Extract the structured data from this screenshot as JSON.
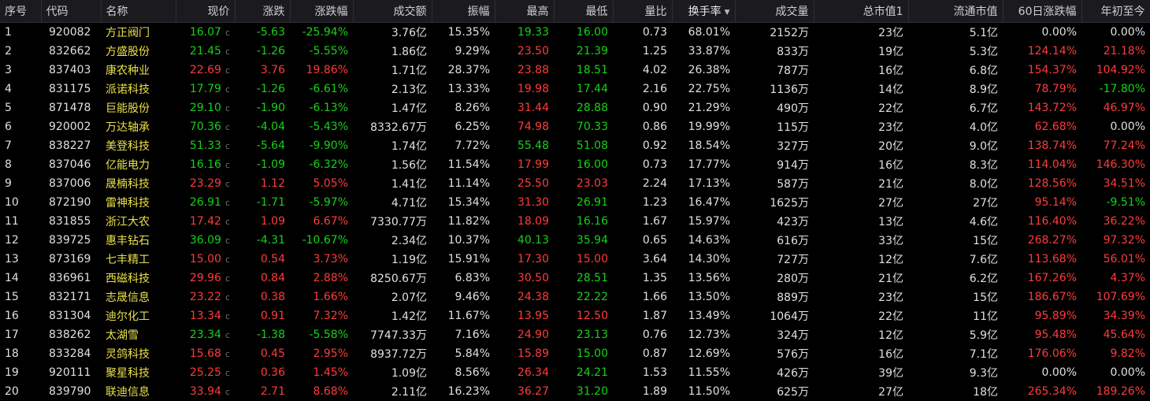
{
  "header": {
    "seq": "序号",
    "code": "代码",
    "name": "名称",
    "price": "现价",
    "change": "涨跌",
    "change_pct": "涨跌幅",
    "amount": "成交额",
    "amplitude": "振幅",
    "high": "最高",
    "low": "最低",
    "vol_ratio": "量比",
    "turnover": "换手率",
    "volume": "成交量",
    "total_cap": "总市值1",
    "float_cap": "流通市值",
    "chg60": "60日涨跌幅",
    "ytd": "年初至今"
  },
  "sort": {
    "column": "turnover",
    "direction": "desc",
    "indicator": "▼"
  },
  "price_suffix": "c",
  "colors": {
    "up": "#ff3b3b",
    "down": "#17d117",
    "flat": "#e0e0e0",
    "background": "#000000",
    "header_bg": "#1b1b1f"
  },
  "rows": [
    {
      "seq": "1",
      "code": "920082",
      "name": "方正阀门",
      "price": "16.07",
      "change": "-5.63",
      "change_pct": "-25.94%",
      "amount": "3.76亿",
      "amplitude": "15.35%",
      "high": "19.33",
      "low": "16.00",
      "vol_ratio": "0.73",
      "turnover": "68.01%",
      "volume": "2152万",
      "total_cap": "23亿",
      "float_cap": "5.1亿",
      "chg60": "0.00%",
      "ytd": "0.00%",
      "c": {
        "price": "g",
        "change": "g",
        "change_pct": "g",
        "high": "g",
        "low": "g",
        "chg60": "w",
        "ytd": "w"
      }
    },
    {
      "seq": "2",
      "code": "832662",
      "name": "方盛股份",
      "price": "21.45",
      "change": "-1.26",
      "change_pct": "-5.55%",
      "amount": "1.86亿",
      "amplitude": "9.29%",
      "high": "23.50",
      "low": "21.39",
      "vol_ratio": "1.25",
      "turnover": "33.87%",
      "volume": "833万",
      "total_cap": "19亿",
      "float_cap": "5.3亿",
      "chg60": "124.14%",
      "ytd": "21.18%",
      "c": {
        "price": "g",
        "change": "g",
        "change_pct": "g",
        "high": "r",
        "low": "g",
        "chg60": "r",
        "ytd": "r"
      }
    },
    {
      "seq": "3",
      "code": "837403",
      "name": "康农种业",
      "price": "22.69",
      "change": "3.76",
      "change_pct": "19.86%",
      "amount": "1.71亿",
      "amplitude": "28.37%",
      "high": "23.88",
      "low": "18.51",
      "vol_ratio": "4.02",
      "turnover": "26.38%",
      "volume": "787万",
      "total_cap": "16亿",
      "float_cap": "6.8亿",
      "chg60": "154.37%",
      "ytd": "104.92%",
      "c": {
        "price": "r",
        "change": "r",
        "change_pct": "r",
        "high": "r",
        "low": "g",
        "chg60": "r",
        "ytd": "r"
      }
    },
    {
      "seq": "4",
      "code": "831175",
      "name": "派诺科技",
      "price": "17.79",
      "change": "-1.26",
      "change_pct": "-6.61%",
      "amount": "2.13亿",
      "amplitude": "13.33%",
      "high": "19.98",
      "low": "17.44",
      "vol_ratio": "2.16",
      "turnover": "22.75%",
      "volume": "1136万",
      "total_cap": "14亿",
      "float_cap": "8.9亿",
      "chg60": "78.79%",
      "ytd": "-17.80%",
      "c": {
        "price": "g",
        "change": "g",
        "change_pct": "g",
        "high": "r",
        "low": "g",
        "chg60": "r",
        "ytd": "g"
      }
    },
    {
      "seq": "5",
      "code": "871478",
      "name": "巨能股份",
      "price": "29.10",
      "change": "-1.90",
      "change_pct": "-6.13%",
      "amount": "1.47亿",
      "amplitude": "8.26%",
      "high": "31.44",
      "low": "28.88",
      "vol_ratio": "0.90",
      "turnover": "21.29%",
      "volume": "490万",
      "total_cap": "22亿",
      "float_cap": "6.7亿",
      "chg60": "143.72%",
      "ytd": "46.97%",
      "c": {
        "price": "g",
        "change": "g",
        "change_pct": "g",
        "high": "r",
        "low": "g",
        "chg60": "r",
        "ytd": "r"
      }
    },
    {
      "seq": "6",
      "code": "920002",
      "name": "万达轴承",
      "price": "70.36",
      "change": "-4.04",
      "change_pct": "-5.43%",
      "amount": "8332.67万",
      "amplitude": "6.25%",
      "high": "74.98",
      "low": "70.33",
      "vol_ratio": "0.86",
      "turnover": "19.99%",
      "volume": "115万",
      "total_cap": "23亿",
      "float_cap": "4.0亿",
      "chg60": "62.68%",
      "ytd": "0.00%",
      "c": {
        "price": "g",
        "change": "g",
        "change_pct": "g",
        "high": "r",
        "low": "g",
        "chg60": "r",
        "ytd": "w"
      }
    },
    {
      "seq": "7",
      "code": "838227",
      "name": "美登科技",
      "price": "51.33",
      "change": "-5.64",
      "change_pct": "-9.90%",
      "amount": "1.74亿",
      "amplitude": "7.72%",
      "high": "55.48",
      "low": "51.08",
      "vol_ratio": "0.92",
      "turnover": "18.54%",
      "volume": "327万",
      "total_cap": "20亿",
      "float_cap": "9.0亿",
      "chg60": "138.74%",
      "ytd": "77.24%",
      "c": {
        "price": "g",
        "change": "g",
        "change_pct": "g",
        "high": "g",
        "low": "g",
        "chg60": "r",
        "ytd": "r"
      }
    },
    {
      "seq": "8",
      "code": "837046",
      "name": "亿能电力",
      "price": "16.16",
      "change": "-1.09",
      "change_pct": "-6.32%",
      "amount": "1.56亿",
      "amplitude": "11.54%",
      "high": "17.99",
      "low": "16.00",
      "vol_ratio": "0.73",
      "turnover": "17.77%",
      "volume": "914万",
      "total_cap": "16亿",
      "float_cap": "8.3亿",
      "chg60": "114.04%",
      "ytd": "146.30%",
      "c": {
        "price": "g",
        "change": "g",
        "change_pct": "g",
        "high": "r",
        "low": "g",
        "chg60": "r",
        "ytd": "r"
      }
    },
    {
      "seq": "9",
      "code": "837006",
      "name": "晟楠科技",
      "price": "23.29",
      "change": "1.12",
      "change_pct": "5.05%",
      "amount": "1.41亿",
      "amplitude": "11.14%",
      "high": "25.50",
      "low": "23.03",
      "vol_ratio": "2.24",
      "turnover": "17.13%",
      "volume": "587万",
      "total_cap": "21亿",
      "float_cap": "8.0亿",
      "chg60": "128.56%",
      "ytd": "34.51%",
      "c": {
        "price": "r",
        "change": "r",
        "change_pct": "r",
        "high": "r",
        "low": "r",
        "chg60": "r",
        "ytd": "r"
      }
    },
    {
      "seq": "10",
      "code": "872190",
      "name": "雷神科技",
      "price": "26.91",
      "change": "-1.71",
      "change_pct": "-5.97%",
      "amount": "4.71亿",
      "amplitude": "15.34%",
      "high": "31.30",
      "low": "26.91",
      "vol_ratio": "1.23",
      "turnover": "16.47%",
      "volume": "1625万",
      "total_cap": "27亿",
      "float_cap": "27亿",
      "chg60": "95.14%",
      "ytd": "-9.51%",
      "c": {
        "price": "g",
        "change": "g",
        "change_pct": "g",
        "high": "r",
        "low": "g",
        "chg60": "r",
        "ytd": "g"
      }
    },
    {
      "seq": "11",
      "code": "831855",
      "name": "浙江大农",
      "price": "17.42",
      "change": "1.09",
      "change_pct": "6.67%",
      "amount": "7330.77万",
      "amplitude": "11.82%",
      "high": "18.09",
      "low": "16.16",
      "vol_ratio": "1.67",
      "turnover": "15.97%",
      "volume": "423万",
      "total_cap": "13亿",
      "float_cap": "4.6亿",
      "chg60": "116.40%",
      "ytd": "36.22%",
      "c": {
        "price": "r",
        "change": "r",
        "change_pct": "r",
        "high": "r",
        "low": "g",
        "chg60": "r",
        "ytd": "r"
      }
    },
    {
      "seq": "12",
      "code": "839725",
      "name": "惠丰钻石",
      "price": "36.09",
      "change": "-4.31",
      "change_pct": "-10.67%",
      "amount": "2.34亿",
      "amplitude": "10.37%",
      "high": "40.13",
      "low": "35.94",
      "vol_ratio": "0.65",
      "turnover": "14.63%",
      "volume": "616万",
      "total_cap": "33亿",
      "float_cap": "15亿",
      "chg60": "268.27%",
      "ytd": "97.32%",
      "c": {
        "price": "g",
        "change": "g",
        "change_pct": "g",
        "high": "g",
        "low": "g",
        "chg60": "r",
        "ytd": "r"
      }
    },
    {
      "seq": "13",
      "code": "873169",
      "name": "七丰精工",
      "price": "15.00",
      "change": "0.54",
      "change_pct": "3.73%",
      "amount": "1.19亿",
      "amplitude": "15.91%",
      "high": "17.30",
      "low": "15.00",
      "vol_ratio": "3.64",
      "turnover": "14.30%",
      "volume": "727万",
      "total_cap": "12亿",
      "float_cap": "7.6亿",
      "chg60": "113.68%",
      "ytd": "56.01%",
      "c": {
        "price": "r",
        "change": "r",
        "change_pct": "r",
        "high": "r",
        "low": "r",
        "chg60": "r",
        "ytd": "r"
      }
    },
    {
      "seq": "14",
      "code": "836961",
      "name": "西磁科技",
      "price": "29.96",
      "change": "0.84",
      "change_pct": "2.88%",
      "amount": "8250.67万",
      "amplitude": "6.83%",
      "high": "30.50",
      "low": "28.51",
      "vol_ratio": "1.35",
      "turnover": "13.56%",
      "volume": "280万",
      "total_cap": "21亿",
      "float_cap": "6.2亿",
      "chg60": "167.26%",
      "ytd": "4.37%",
      "c": {
        "price": "r",
        "change": "r",
        "change_pct": "r",
        "high": "r",
        "low": "g",
        "chg60": "r",
        "ytd": "r"
      }
    },
    {
      "seq": "15",
      "code": "832171",
      "name": "志晟信息",
      "price": "23.22",
      "change": "0.38",
      "change_pct": "1.66%",
      "amount": "2.07亿",
      "amplitude": "9.46%",
      "high": "24.38",
      "low": "22.22",
      "vol_ratio": "1.66",
      "turnover": "13.50%",
      "volume": "889万",
      "total_cap": "23亿",
      "float_cap": "15亿",
      "chg60": "186.67%",
      "ytd": "107.69%",
      "c": {
        "price": "r",
        "change": "r",
        "change_pct": "r",
        "high": "r",
        "low": "g",
        "chg60": "r",
        "ytd": "r"
      }
    },
    {
      "seq": "16",
      "code": "831304",
      "name": "迪尔化工",
      "price": "13.34",
      "change": "0.91",
      "change_pct": "7.32%",
      "amount": "1.42亿",
      "amplitude": "11.67%",
      "high": "13.95",
      "low": "12.50",
      "vol_ratio": "1.87",
      "turnover": "13.49%",
      "volume": "1064万",
      "total_cap": "22亿",
      "float_cap": "11亿",
      "chg60": "95.89%",
      "ytd": "34.39%",
      "c": {
        "price": "r",
        "change": "r",
        "change_pct": "r",
        "high": "r",
        "low": "r",
        "chg60": "r",
        "ytd": "r"
      }
    },
    {
      "seq": "17",
      "code": "838262",
      "name": "太湖雪",
      "price": "23.34",
      "change": "-1.38",
      "change_pct": "-5.58%",
      "amount": "7747.33万",
      "amplitude": "7.16%",
      "high": "24.90",
      "low": "23.13",
      "vol_ratio": "0.76",
      "turnover": "12.73%",
      "volume": "324万",
      "total_cap": "12亿",
      "float_cap": "5.9亿",
      "chg60": "95.48%",
      "ytd": "45.64%",
      "c": {
        "price": "g",
        "change": "g",
        "change_pct": "g",
        "high": "r",
        "low": "g",
        "chg60": "r",
        "ytd": "r"
      }
    },
    {
      "seq": "18",
      "code": "833284",
      "name": "灵鸽科技",
      "price": "15.68",
      "change": "0.45",
      "change_pct": "2.95%",
      "amount": "8937.72万",
      "amplitude": "5.84%",
      "high": "15.89",
      "low": "15.00",
      "vol_ratio": "0.87",
      "turnover": "12.69%",
      "volume": "576万",
      "total_cap": "16亿",
      "float_cap": "7.1亿",
      "chg60": "176.06%",
      "ytd": "9.82%",
      "c": {
        "price": "r",
        "change": "r",
        "change_pct": "r",
        "high": "r",
        "low": "g",
        "chg60": "r",
        "ytd": "r"
      }
    },
    {
      "seq": "19",
      "code": "920111",
      "name": "聚星科技",
      "price": "25.25",
      "change": "0.36",
      "change_pct": "1.45%",
      "amount": "1.09亿",
      "amplitude": "8.56%",
      "high": "26.34",
      "low": "24.21",
      "vol_ratio": "1.53",
      "turnover": "11.55%",
      "volume": "426万",
      "total_cap": "39亿",
      "float_cap": "9.3亿",
      "chg60": "0.00%",
      "ytd": "0.00%",
      "c": {
        "price": "r",
        "change": "r",
        "change_pct": "r",
        "high": "r",
        "low": "g",
        "chg60": "w",
        "ytd": "w"
      }
    },
    {
      "seq": "20",
      "code": "839790",
      "name": "联迪信息",
      "price": "33.94",
      "change": "2.71",
      "change_pct": "8.68%",
      "amount": "2.11亿",
      "amplitude": "16.23%",
      "high": "36.27",
      "low": "31.20",
      "vol_ratio": "1.89",
      "turnover": "11.50%",
      "volume": "625万",
      "total_cap": "27亿",
      "float_cap": "18亿",
      "chg60": "265.34%",
      "ytd": "189.26%",
      "c": {
        "price": "r",
        "change": "r",
        "change_pct": "r",
        "high": "r",
        "low": "g",
        "chg60": "r",
        "ytd": "r"
      }
    }
  ]
}
